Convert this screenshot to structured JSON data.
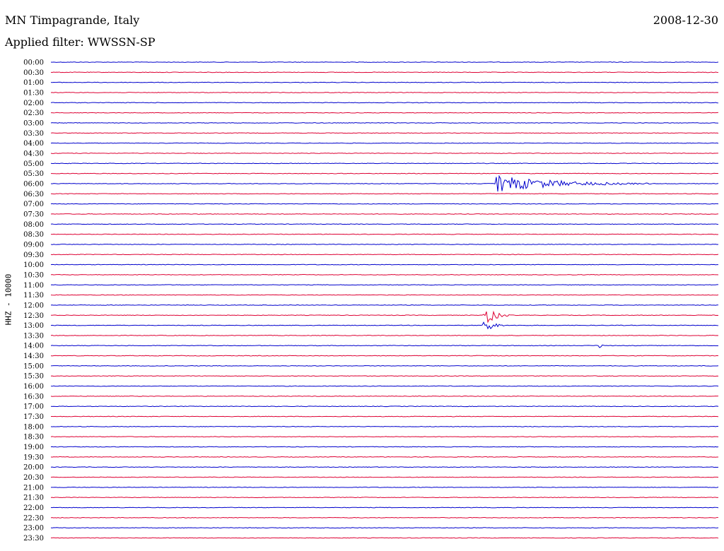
{
  "header": {
    "title": "MN Timpagrande, Italy",
    "date": "2008-12-30",
    "filter": "Applied filter: WWSSN-SP"
  },
  "chart_data": {
    "type": "line",
    "title": "MN Timpagrande, Italy",
    "date": "2008-12-30",
    "filter": "WWSSN-SP",
    "ylabel": "HHZ - 10000",
    "grid": false,
    "colors": {
      "even": "#0000cc",
      "odd": "#dd0033"
    },
    "rows": [
      "00:00",
      "00:30",
      "01:00",
      "01:30",
      "02:00",
      "02:30",
      "03:00",
      "03:30",
      "04:00",
      "04:30",
      "05:00",
      "05:30",
      "06:00",
      "06:30",
      "07:00",
      "07:30",
      "08:00",
      "08:30",
      "09:00",
      "09:30",
      "10:00",
      "10:30",
      "11:00",
      "11:30",
      "12:00",
      "12:30",
      "13:00",
      "13:30",
      "14:00",
      "14:30",
      "15:00",
      "15:30",
      "16:00",
      "16:30",
      "17:00",
      "17:30",
      "18:00",
      "18:30",
      "19:00",
      "19:30",
      "20:00",
      "20:30",
      "21:00",
      "21:30",
      "22:00",
      "22:30",
      "23:00",
      "23:30"
    ],
    "events": [
      {
        "row": "06:00",
        "start_min": 20.0,
        "amplitude": 0.9,
        "duration_min": 7.0
      },
      {
        "row": "12:30",
        "start_min": 19.4,
        "amplitude": 1.35,
        "duration_min": 1.2
      },
      {
        "row": "13:00",
        "start_min": 19.4,
        "amplitude": 1.0,
        "duration_min": 1.0
      },
      {
        "row": "14:00",
        "start_min": 24.6,
        "amplitude": 0.6,
        "duration_min": 0.3
      }
    ]
  }
}
